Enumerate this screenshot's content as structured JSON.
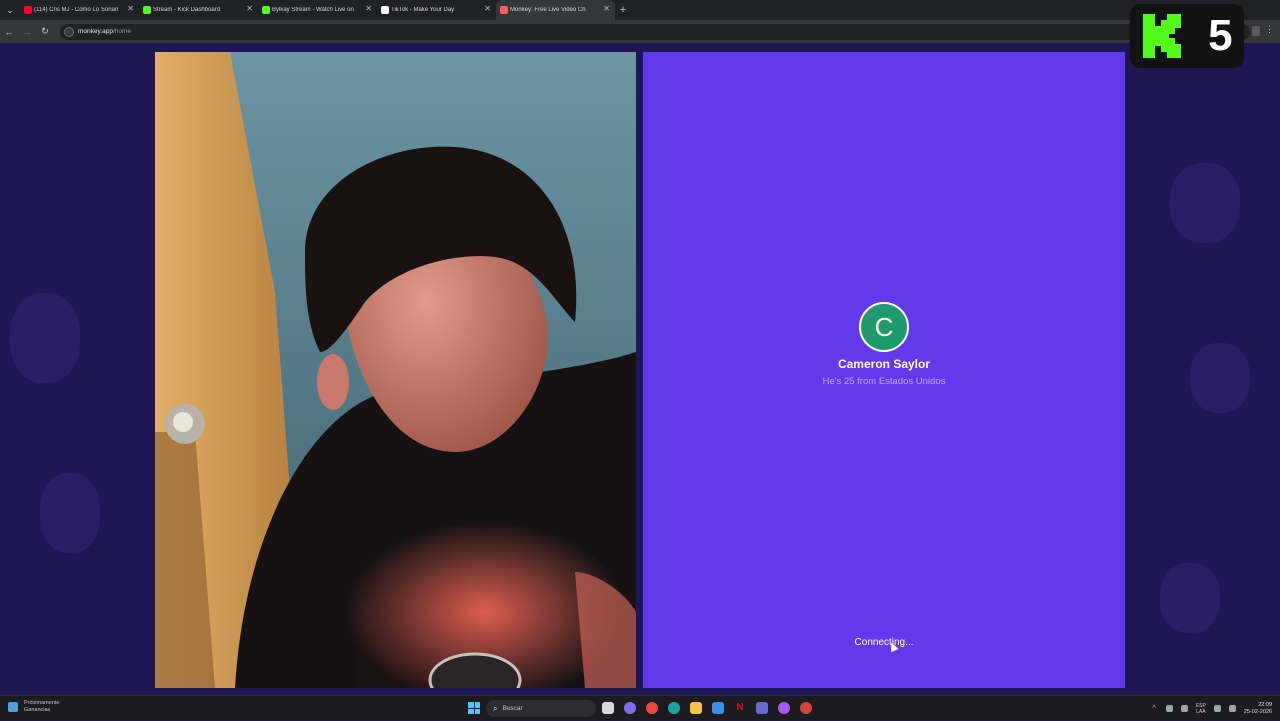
{
  "browser": {
    "tabs": [
      {
        "title": "(114) Cris MJ - Como Lo Soñam",
        "favicon_color": "#ff0033",
        "active": false
      },
      {
        "title": "Stream - Kick Dashboard",
        "favicon_color": "#53fc18",
        "active": false
      },
      {
        "title": "Bylkay Stream - Watch Live on",
        "favicon_color": "#53fc18",
        "active": false
      },
      {
        "title": "TikTok - Make Your Day",
        "favicon_color": "#ffffff",
        "active": false
      },
      {
        "title": "Monkey: Free Live Video Ch",
        "favicon_color": "#ff5c5c",
        "active": true
      }
    ],
    "url_host": "monkey.app",
    "url_path": "/home"
  },
  "stream_badge": {
    "number": "5",
    "brand_color": "#53fc18"
  },
  "remote": {
    "avatar_letter": "C",
    "avatar_color": "#1e9a6e",
    "name": "Cameron Saylor",
    "meta": "He's 25 from Estados Unidos",
    "status": "Connecting...",
    "panel_color": "#6339ec"
  },
  "taskbar": {
    "weather": "Próximamente Ganancias",
    "search_placeholder": "Buscar",
    "lang_top": "ESP",
    "lang_bottom": "LAA",
    "time": "22:09",
    "date": "25-02-2026"
  }
}
